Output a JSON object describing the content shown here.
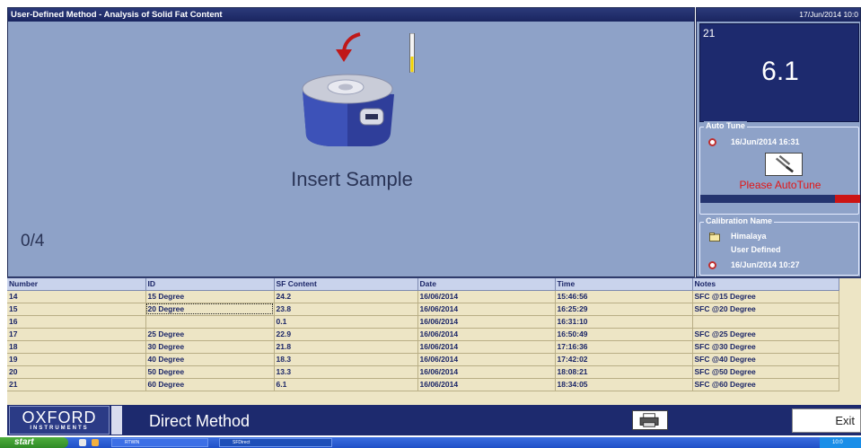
{
  "window": {
    "title": "User-Defined Method - Analysis of Solid Fat Content",
    "datetime": "17/Jun/2014 10:0"
  },
  "main": {
    "instruction": "Insert Sample",
    "progress": "0/4"
  },
  "reading": {
    "number": "21",
    "value": "6.1"
  },
  "auto_tune": {
    "title": "Auto Tune",
    "date": "16/Jun/2014 16:31",
    "warning": "Please AutoTune",
    "warning_color": "#e21616",
    "status_fill_fraction": 0.84
  },
  "calibration": {
    "title": "Calibration Name",
    "name": "Himalaya",
    "type": "User Defined",
    "date": "16/Jun/2014 10:27"
  },
  "table": {
    "headers": [
      "Number",
      "ID",
      "SF Content",
      "Date",
      "Time",
      "Notes"
    ],
    "rows": [
      [
        "14",
        "15 Degree",
        "24.2",
        "16/06/2014",
        "15:46:56",
        "SFC @15 Degree"
      ],
      [
        "15",
        "20 Degree",
        "23.8",
        "16/06/2014",
        "16:25:29",
        "SFC @20 Degree"
      ],
      [
        "16",
        "",
        "0.1",
        "16/06/2014",
        "16:31:10",
        ""
      ],
      [
        "17",
        "25 Degree",
        "22.9",
        "16/06/2014",
        "16:50:49",
        "SFC @25 Degree"
      ],
      [
        "18",
        "30 Degree",
        "21.8",
        "16/06/2014",
        "17:16:36",
        "SFC @30 Degree"
      ],
      [
        "19",
        "40 Degree",
        "18.3",
        "16/06/2014",
        "17:42:02",
        "SFC @40 Degree"
      ],
      [
        "20",
        "50 Degree",
        "13.3",
        "16/06/2014",
        "18:08:21",
        "SFC @50 Degree"
      ],
      [
        "21",
        "60 Degree",
        "6.1",
        "16/06/2014",
        "18:34:05",
        "SFC @60 Degree"
      ]
    ]
  },
  "bottom": {
    "logo_top": "OXFORD",
    "logo_bottom": "INSTRUMENTS",
    "method": "Direct Method",
    "exit_label": "Exit"
  },
  "taskbar": {
    "start_label": "start",
    "tasks": [
      "RTWIN",
      "SFDirect"
    ],
    "clock": "10:0"
  },
  "colors": {
    "panel": "#8ea2c8",
    "navy": "#1d2a6e",
    "table_row": "#ede5c5"
  }
}
